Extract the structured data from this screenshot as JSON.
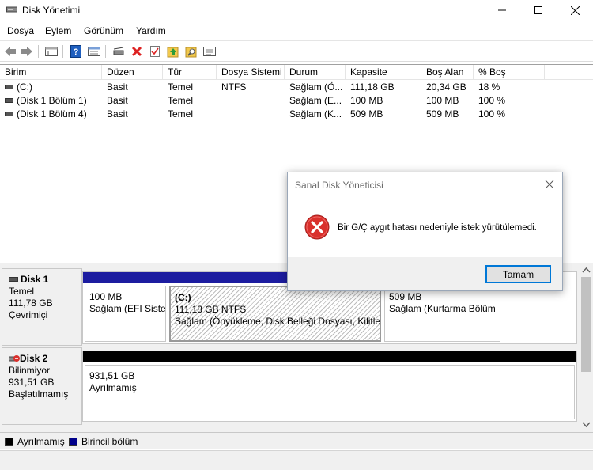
{
  "window": {
    "title": "Disk Yönetimi"
  },
  "menu": [
    "Dosya",
    "Eylem",
    "Görünüm",
    "Yardım"
  ],
  "toolbar_icons": [
    "back-icon",
    "forward-icon",
    "properties-icon",
    "help-icon",
    "console-tree-icon",
    "connect-icon",
    "delete-icon",
    "check-icon",
    "up-icon",
    "search-icon",
    "list-icon"
  ],
  "volumes": {
    "columns": [
      "Birim",
      "Düzen",
      "Tür",
      "Dosya Sistemi",
      "Durum",
      "Kapasite",
      "Boş Alan",
      "% Boş"
    ],
    "rows": [
      [
        "(C:)",
        "Basit",
        "Temel",
        "NTFS",
        "Sağlam (Ö...",
        "111,18 GB",
        "20,34 GB",
        "18 %"
      ],
      [
        "(Disk 1 Bölüm 1)",
        "Basit",
        "Temel",
        "",
        "Sağlam (E...",
        "100 MB",
        "100 MB",
        "100 %"
      ],
      [
        "(Disk 1 Bölüm 4)",
        "Basit",
        "Temel",
        "",
        "Sağlam (K...",
        "509 MB",
        "509 MB",
        "100 %"
      ]
    ]
  },
  "disks": [
    {
      "name": "Disk 1",
      "type": "Temel",
      "size": "111,78 GB",
      "status": "Çevrimiçi",
      "partitions": [
        {
          "label": "",
          "size": "100 MB",
          "status": "Sağlam (EFI Sister"
        },
        {
          "label": "(C:)",
          "size": "111,18 GB NTFS",
          "status": "Sağlam (Önyükleme, Disk Belleği Dosyası, Kilitlen"
        },
        {
          "label": "",
          "size": "509 MB",
          "status": "Sağlam (Kurtarma Bölüm"
        }
      ]
    },
    {
      "name": "Disk 2",
      "type": "Bilinmiyor",
      "size": "931,51 GB",
      "status": "Başlatılmamış",
      "partitions": [
        {
          "size": "931,51 GB",
          "status": "Ayrılmamış"
        }
      ]
    }
  ],
  "legend": [
    {
      "label": "Ayrılmamış",
      "color": "#000000"
    },
    {
      "label": "Birincil bölüm",
      "color": "#00008b"
    }
  ],
  "dialog": {
    "title": "Sanal Disk Yöneticisi",
    "message": "Bir G/Ç aygıt hatası nedeniyle istek yürütülemedi.",
    "ok_label": "Tamam",
    "icon": "error-icon"
  },
  "colors": {
    "primary_partition": "#1c1ca0",
    "unallocated": "#000000",
    "error_red": "#d9302c"
  }
}
